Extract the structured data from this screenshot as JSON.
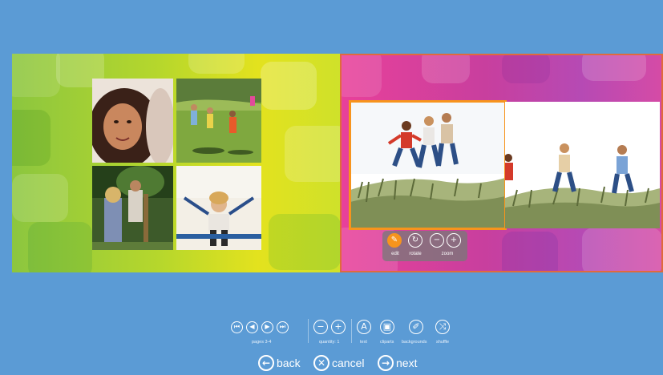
{
  "colors": {
    "background": "#5b9bd5",
    "accent": "#f7941d",
    "left_page": "#8cc63f",
    "right_page": "#c83f9e"
  },
  "photo_toolbar": {
    "edit_label": "edit",
    "rotate_label": "rotate",
    "zoom_label": "zoom"
  },
  "toolbar": {
    "pages_label": "pages 3-4",
    "quantity_label": "quantity: 1",
    "text_label": "text",
    "cliparts_label": "cliparts",
    "backgrounds_label": "backgrounds",
    "shuffle_label": "shuffle"
  },
  "nav": {
    "back_label": "back",
    "cancel_label": "cancel",
    "next_label": "next"
  },
  "icons": [
    "first-page-icon",
    "prev-page-icon",
    "next-page-icon",
    "last-page-icon",
    "minus-icon",
    "plus-icon",
    "text-icon",
    "cliparts-icon",
    "backgrounds-icon",
    "shuffle-icon",
    "edit-icon",
    "rotate-icon",
    "zoom-out-icon",
    "zoom-in-icon",
    "back-arrow-icon",
    "cancel-x-icon",
    "next-arrow-icon"
  ]
}
